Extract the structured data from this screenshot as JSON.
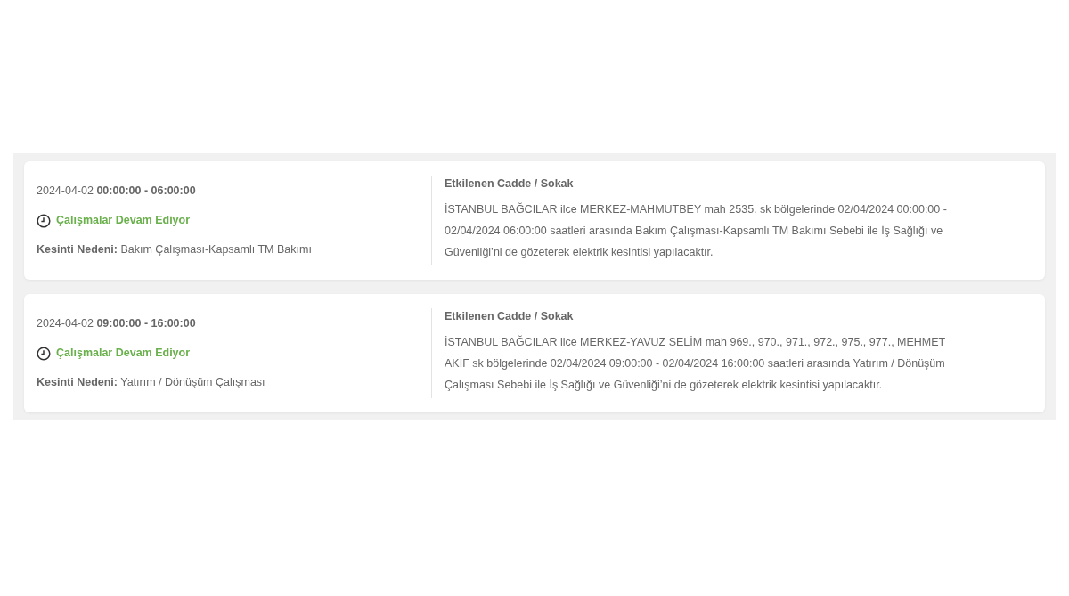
{
  "outages": [
    {
      "time": "2024-04-02 **00:00:00 - 06:00:00**",
      "status": "Çalışmalar Devam Ediyor",
      "reason": "**Kesinti Nedeni:** Bakım Çalışması-Kapsamlı TM Bakımı",
      "heading": "Etkilenen Cadde / Sokak",
      "description": "İSTANBUL BAĞCILAR ilce MERKEZ-MAHMUTBEY mah 2535. sk bölgelerinde 02/04/2024 00:00:00 - 02/04/2024 06:00:00 saatleri arasında Bakım Çalışması-Kapsamlı TM Bakımı Sebebi ile İş Sağlığı ve Güvenliği’ni de gözeterek elektrik kesintisi yapılacaktır."
    },
    {
      "time": "2024-04-02 **09:00:00 - 16:00:00**",
      "status": "Çalışmalar Devam Ediyor",
      "reason": "**Kesinti Nedeni:** Yatırım / Dönüşüm Çalışması",
      "heading": "Etkilenen Cadde / Sokak",
      "description": "İSTANBUL BAĞCILAR ilce MERKEZ-YAVUZ SELİM mah 969., 970., 971., 972., 975., 977., MEHMET AKİF sk bölgelerinde 02/04/2024 09:00:00 - 02/04/2024 16:00:00 saatleri arasında Yatırım / Dönüşüm Çalışması Sebebi ile İş Sağlığı ve Güvenliği’ni de gözeterek elektrik kesintisi yapılacaktır."
    }
  ]
}
